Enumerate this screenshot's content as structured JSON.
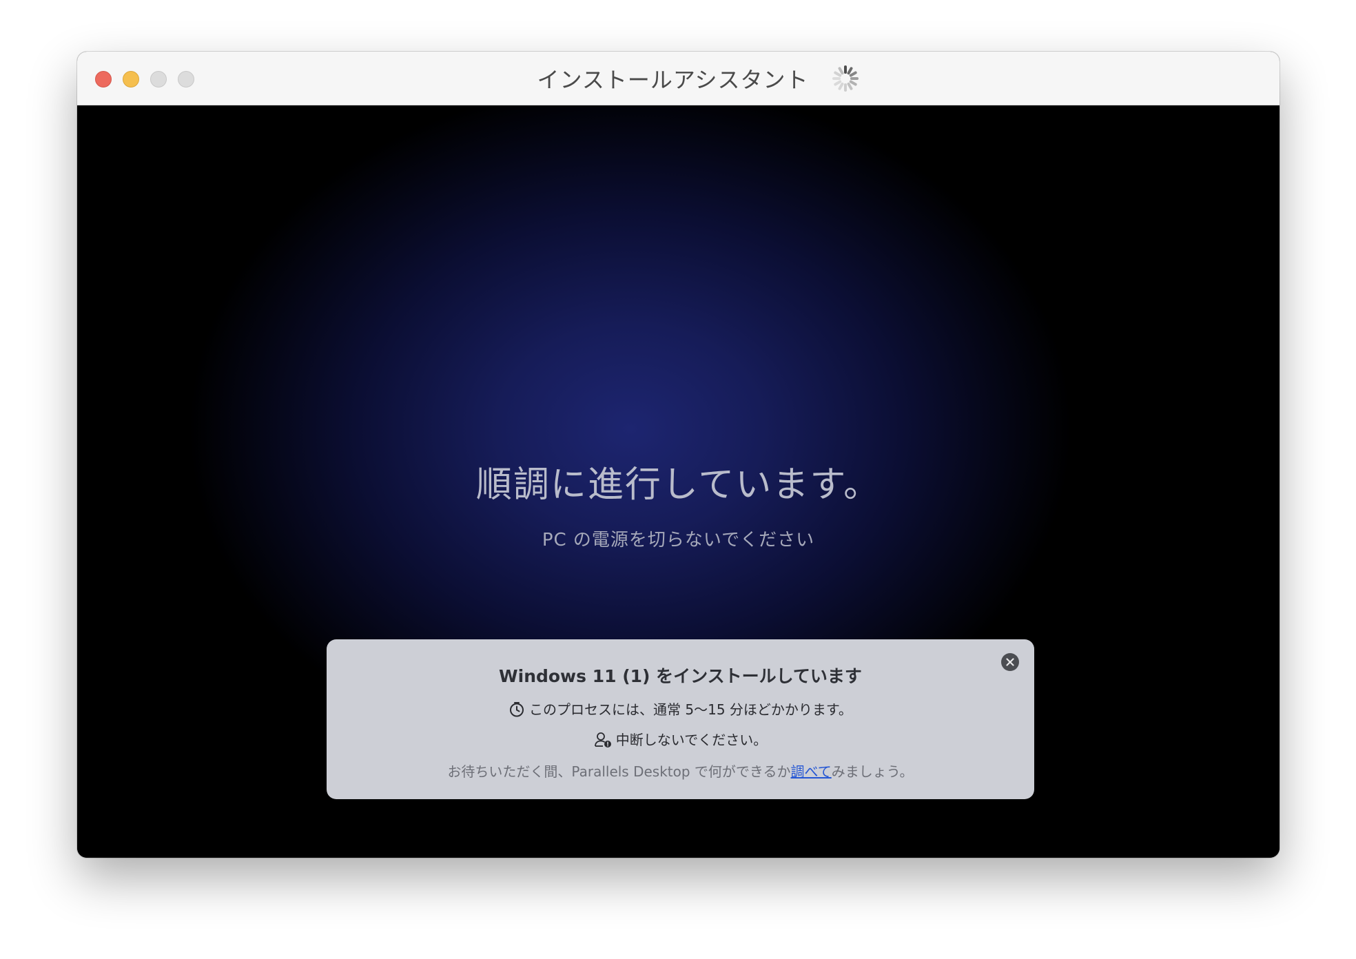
{
  "window": {
    "title": "インストールアシスタント",
    "buttons": {
      "close_color": "#ed6a5e",
      "minimize_color": "#f5bf4f",
      "zoom_color": "#dcdcdc"
    }
  },
  "screen": {
    "headline": "順調に進行しています。",
    "subline": "PC の電源を切らないでください"
  },
  "panel": {
    "title": "Windows 11 (1) をインストールしています",
    "duration_text": "このプロセスには、通常 5～15 分ほどかかります。",
    "warning_text": "中断しないでください。",
    "footer_before": "お待ちいただく間、Parallels Desktop で何ができるか",
    "footer_link": "調べて",
    "footer_after": "みましょう。",
    "icons": {
      "duration": "timer-icon",
      "warning": "user-alert-icon",
      "close": "close-circle-icon"
    }
  }
}
